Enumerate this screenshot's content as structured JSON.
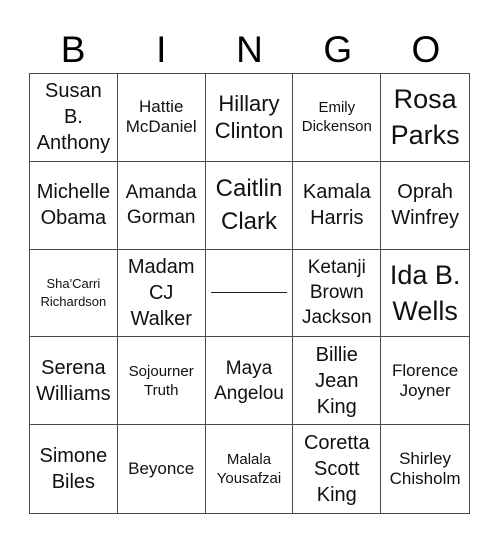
{
  "header": {
    "letters": [
      "B",
      "I",
      "N",
      "G",
      "O"
    ]
  },
  "card": {
    "cells": [
      "Susan\nB.\nAnthony",
      "Hattie\nMcDaniel",
      "Hillary\nClinton",
      "Emily\nDickenson",
      "Rosa\nParks",
      "Michelle\nObama",
      "Amanda\nGorman",
      "Caitlin\nClark",
      "Kamala\nHarris",
      "Oprah\nWinfrey",
      "Sha'Carri\nRichardson",
      "Madam\nCJ\nWalker",
      "",
      "Ketanji\nBrown\nJackson",
      "Ida B.\nWells",
      "Serena\nWilliams",
      "Sojourner\nTruth",
      "Maya\nAngelou",
      "Billie\nJean\nKing",
      "Florence\nJoyner",
      "Simone\nBiles",
      "Beyonce",
      "Malala\nYousafzai",
      "Coretta\nScott\nKing",
      "Shirley\nChisholm"
    ],
    "free_space": "blank line"
  }
}
